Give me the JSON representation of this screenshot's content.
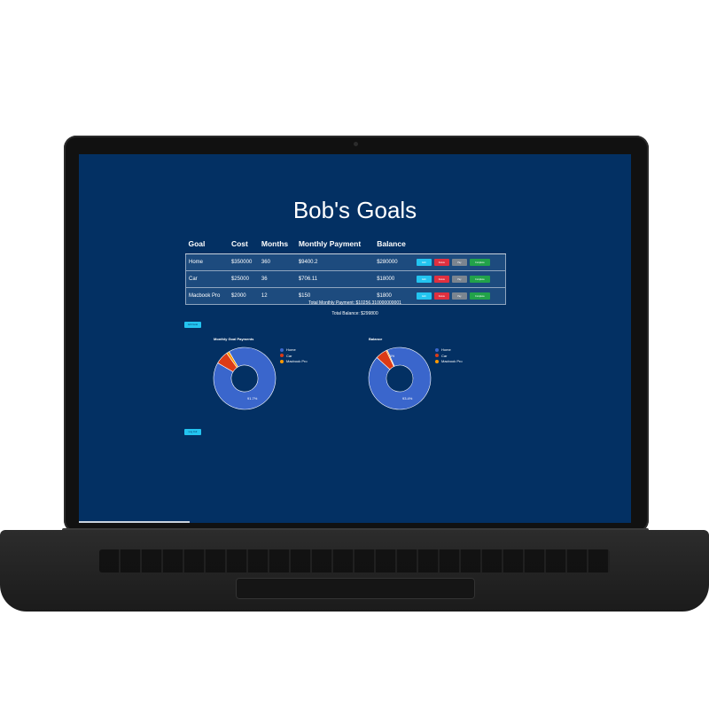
{
  "app": {
    "title": "Bob's Goals"
  },
  "table": {
    "headers": [
      "Goal",
      "Cost",
      "Months",
      "Monthly Payment",
      "Balance"
    ],
    "rows": [
      {
        "goal": "Home",
        "cost": "$350000",
        "months": "360",
        "monthly": "$9400.2",
        "balance": "$280000"
      },
      {
        "goal": "Car",
        "cost": "$25000",
        "months": "36",
        "monthly": "$706.11",
        "balance": "$18000"
      },
      {
        "goal": "Macbook Pro",
        "cost": "$2000",
        "months": "12",
        "monthly": "$150",
        "balance": "$1800"
      }
    ],
    "actions": {
      "edit": "Edit",
      "delete": "Delete",
      "pay": "Pay",
      "complete": "Complete"
    }
  },
  "totals": {
    "monthly_payment": "Total Monthly Payment: $10256.310000000001",
    "balance": "Total Balance: $299800"
  },
  "buttons": {
    "add_goal": "Add Goal",
    "log_out": "Log Out"
  },
  "charts": {
    "colors": {
      "Home": "#3a66cc",
      "Car": "#dc3b16",
      "Macbook Pro": "#ff9900"
    },
    "legend": [
      "Home",
      "Car",
      "Macbook Pro"
    ]
  },
  "chart_data": [
    {
      "type": "pie",
      "title": "Monthly Goal Payments",
      "categories": [
        "Home",
        "Car",
        "Macbook Pro"
      ],
      "values": [
        9400.2,
        706.11,
        150
      ],
      "center_label": "91.7%"
    },
    {
      "type": "pie",
      "title": "Balance",
      "categories": [
        "Home",
        "Car",
        "Macbook Pro"
      ],
      "values": [
        280000,
        18000,
        1800
      ],
      "center_label": "93.4%",
      "small_label": "6%"
    }
  ]
}
